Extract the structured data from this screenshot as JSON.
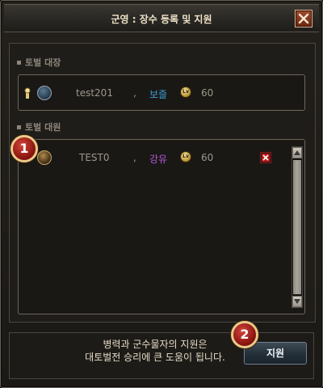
{
  "window": {
    "title": "군영 : 장수 등록 및 지원"
  },
  "sections": {
    "leader_title": "토벌 대장",
    "members_title": "토벌 대원"
  },
  "leader": {
    "name": "test201",
    "separator": ",",
    "class_name": "보즐",
    "level": "60",
    "class_color": "#3fa0d8"
  },
  "members": [
    {
      "name": "TEST0",
      "separator": ",",
      "class_name": "강유",
      "level": "60",
      "class_color": "#b05ad6"
    }
  ],
  "bottom": {
    "info_line1": "병력과 군수물자의 지원은",
    "info_line2": "대토벌전 승리에 큰 도움이 됩니다.",
    "support_label": "지원"
  },
  "badges": {
    "one": "1",
    "two": "2"
  },
  "icons": {
    "close": "close-icon",
    "level": "level-icon",
    "remove": "remove-icon",
    "scroll_up": "scroll-up-icon",
    "scroll_down": "scroll-down-icon"
  },
  "level_icon_text": "Lv"
}
